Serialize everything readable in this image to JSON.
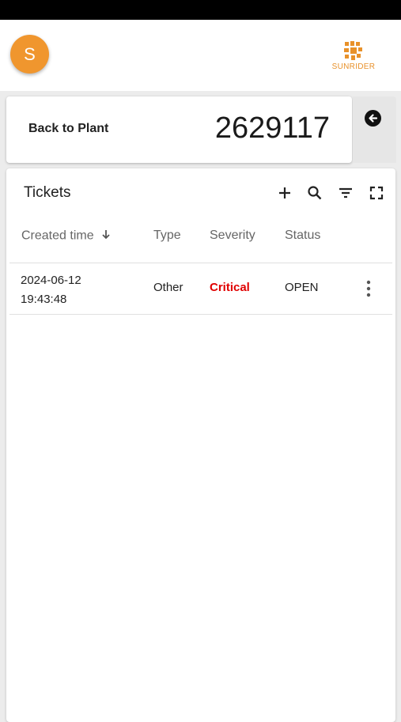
{
  "user": {
    "avatar_initial": "S"
  },
  "brand": {
    "name": "SUNRIDER",
    "color": "#e8912a"
  },
  "plant": {
    "back_label": "Back to Plant",
    "id": "2629117"
  },
  "tickets": {
    "title": "Tickets",
    "toolbar": [
      "add-icon",
      "search-icon",
      "filter-icon",
      "fullscreen-icon"
    ],
    "columns": {
      "created": "Created time",
      "type": "Type",
      "severity": "Severity",
      "status": "Status"
    },
    "rows": [
      {
        "date": "2024-06-12",
        "time": "19:43:48",
        "type": "Other",
        "severity": "Critical",
        "status": "OPEN"
      }
    ]
  },
  "colors": {
    "avatar": "#f0962e",
    "critical": "#e00000"
  }
}
